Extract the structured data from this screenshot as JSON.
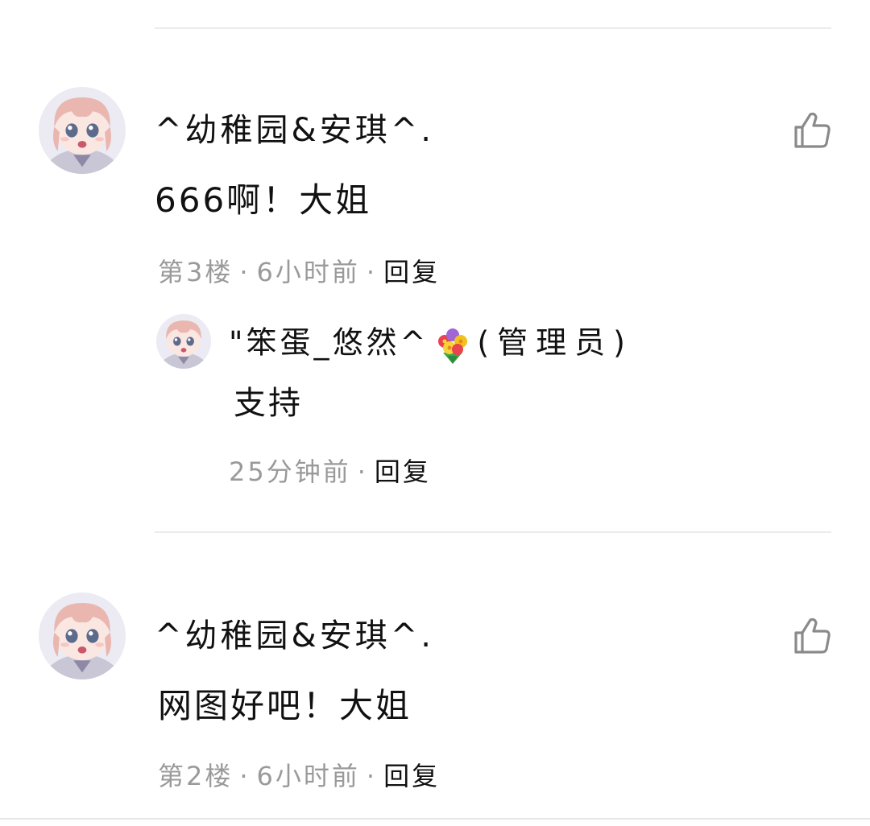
{
  "comments": [
    {
      "username": "^幼稚园&安琪^.",
      "content": "666啊！大姐",
      "floor": "第3楼",
      "time": "6小时前",
      "reply_label": "回复",
      "reply": {
        "username": "\"笨蛋_悠然^",
        "badge_icon": "flower-bouquet-icon",
        "role": "(管理员)",
        "content": "支持",
        "time": "25分钟前",
        "reply_label": "回复"
      }
    },
    {
      "username": "^幼稚园&安琪^.",
      "content": "网图好吧！大姐",
      "floor": "第2楼",
      "time": "6小时前",
      "reply_label": "回复"
    }
  ],
  "separator": "·",
  "colors": {
    "text": "#111111",
    "meta": "#9a9a9a",
    "divider": "#ebebeb",
    "icon": "#8a8a8a"
  }
}
